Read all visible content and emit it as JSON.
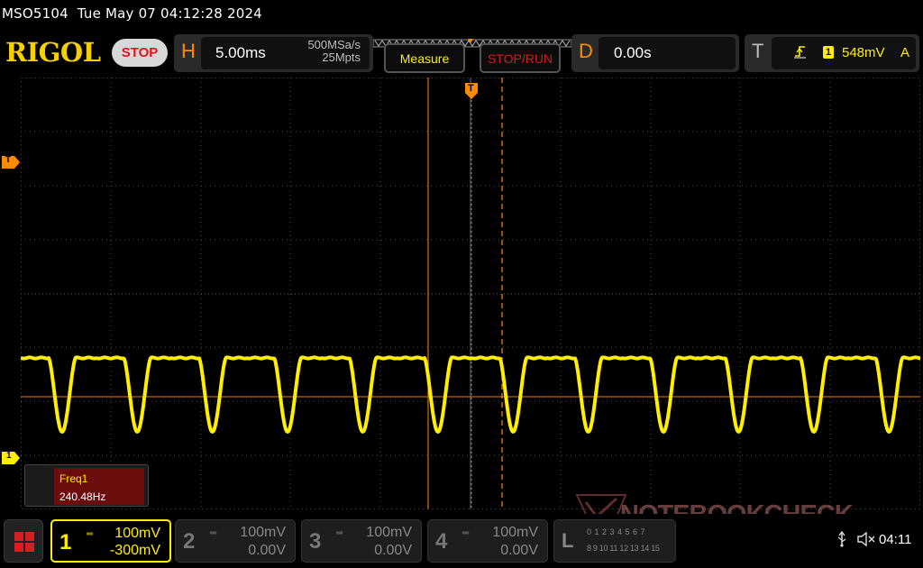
{
  "status": {
    "model": "MSO5104",
    "datetime": "Tue May 07 04:12:28 2024"
  },
  "header": {
    "logo": "RIGOL",
    "run_state": "STOP",
    "horizontal": {
      "letter": "H",
      "timebase": "5.00ms",
      "sample_rate": "500MSa/s",
      "memory_depth": "25Mpts"
    },
    "measure_label": "Measure",
    "stoprun_label": "STOP/RUN",
    "delay": {
      "letter": "D",
      "value": "0.00s"
    },
    "trigger": {
      "letter": "T",
      "source": "1",
      "level": "548mV",
      "mode": "A"
    }
  },
  "markers": {
    "trigger_level": "T",
    "channel1": "1",
    "trigger_position": "T"
  },
  "measurement": {
    "label": "Freq1",
    "value": "240.48Hz"
  },
  "channels": [
    {
      "num": "1",
      "scale": "100mV",
      "offset": "-300mV",
      "active": true
    },
    {
      "num": "2",
      "scale": "100mV",
      "offset": "0.00V",
      "active": false
    },
    {
      "num": "3",
      "scale": "100mV",
      "offset": "0.00V",
      "active": false
    },
    {
      "num": "4",
      "scale": "100mV",
      "offset": "0.00V",
      "active": false
    }
  ],
  "logic": {
    "letter": "L",
    "row1": "0 1 2 3 4 5 6 7",
    "row2": "8 9 10 11 12 13 14 15"
  },
  "clock": "04:11",
  "watermark": "NOTEBOOKCHECK",
  "colors": {
    "ch1": "#ffee00",
    "accent_orange": "#ff8a00",
    "stop_red": "#e0141e",
    "grid": "#5a5a5a"
  },
  "icons": [
    "menu-icon",
    "usb-icon",
    "speaker-mute-icon",
    "trigger-edge-icon"
  ]
}
